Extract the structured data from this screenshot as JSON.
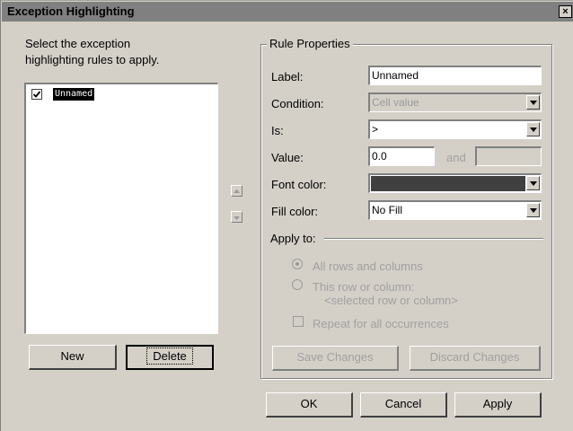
{
  "window": {
    "title": "Exception Highlighting",
    "close_glyph": "×"
  },
  "left": {
    "instruction_line1": "Select the exception",
    "instruction_line2": "highlighting rules to apply.",
    "rules": [
      {
        "label": "Unnamed",
        "checked": true,
        "selected": true
      }
    ],
    "new_label": "New",
    "delete_label": "Delete",
    "move_up_icon": "triangle-up-icon",
    "move_down_icon": "triangle-down-icon"
  },
  "rule_properties": {
    "legend": "Rule Properties",
    "label_caption": "Label:",
    "label_value": "Unnamed",
    "condition_caption": "Condition:",
    "condition_value": "Cell value",
    "is_caption": "Is:",
    "is_value": ">",
    "value_caption": "Value:",
    "value_value": "0.0",
    "and_caption": "and",
    "value2_value": "",
    "font_color_caption": "Font color:",
    "font_color_swatch": "#404040",
    "fill_color_caption": "Fill color:",
    "fill_color_value": "No Fill",
    "apply_to_caption": "Apply to:",
    "radio_all": "All rows and columns",
    "radio_this_line1": "This row or column:",
    "radio_this_line2": "<selected row or column>",
    "repeat_label": "Repeat for all occurrences",
    "save_label": "Save Changes",
    "discard_label": "Discard Changes"
  },
  "footer": {
    "ok_label": "OK",
    "cancel_label": "Cancel",
    "apply_label": "Apply"
  }
}
